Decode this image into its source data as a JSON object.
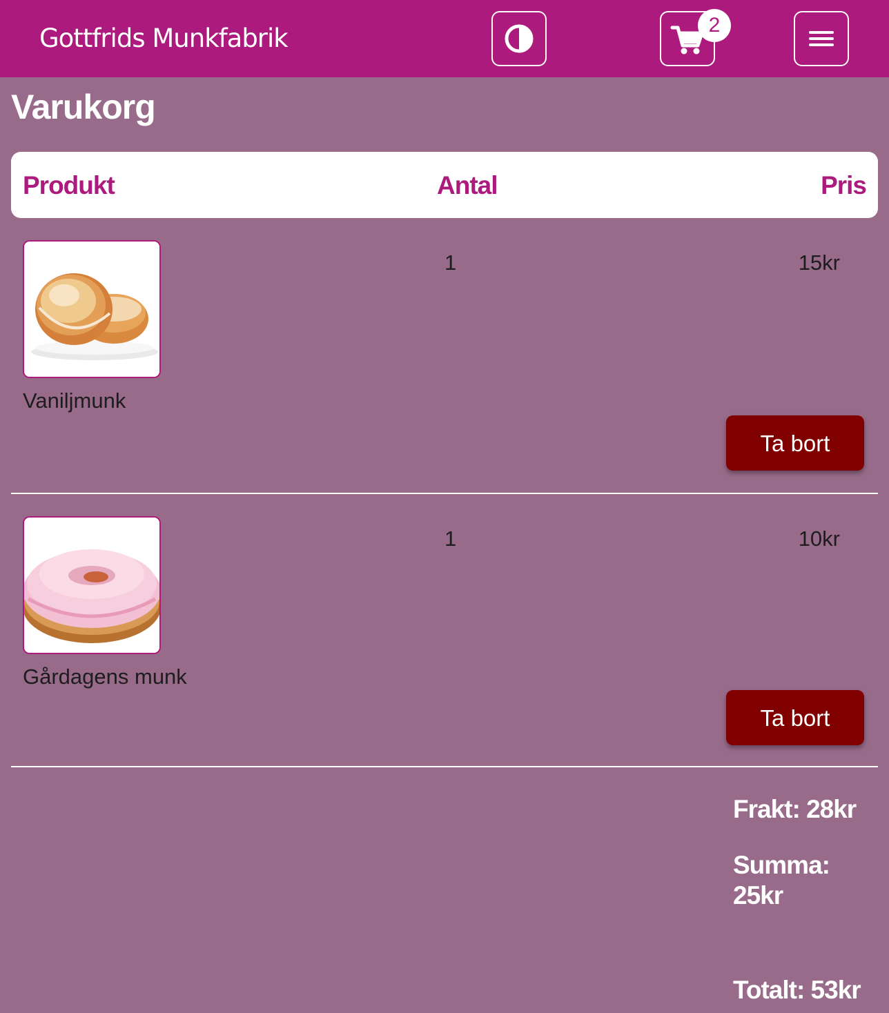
{
  "header": {
    "brand": "Gottfrids Munkfabrik",
    "cart_count": "2"
  },
  "page": {
    "title": "Varukorg"
  },
  "table": {
    "columns": {
      "product": "Produkt",
      "quantity": "Antal",
      "price": "Pris"
    },
    "rows": [
      {
        "name": "Vaniljmunk",
        "quantity": "1",
        "price": "15kr",
        "remove_label": "Ta bort"
      },
      {
        "name": "Gårdagens munk",
        "quantity": "1",
        "price": "10kr",
        "remove_label": "Ta bort"
      }
    ]
  },
  "totals": {
    "shipping": "Frakt: 28kr",
    "sum": "Summa: 25kr",
    "total": "Totalt: 53kr"
  },
  "colors": {
    "header_bg": "#ad1a7d",
    "page_bg": "#986b8a",
    "accent": "#ad1a7d",
    "remove_button": "#800000"
  }
}
